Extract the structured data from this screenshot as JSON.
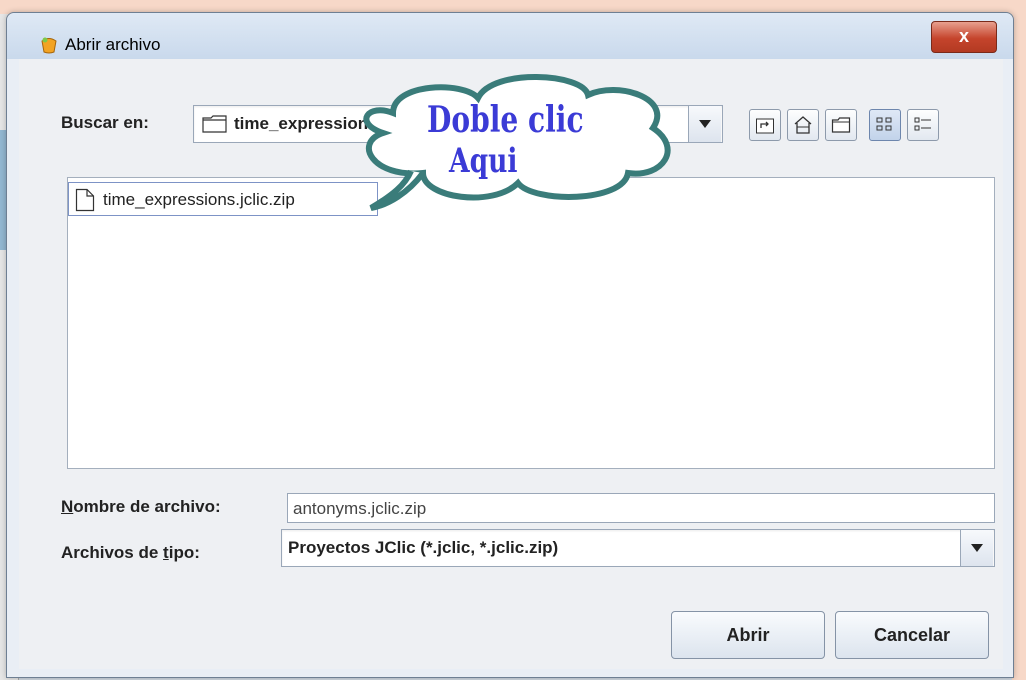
{
  "dialog": {
    "title": "Abrir archivo",
    "close_glyph": "x",
    "look_in_label": "Buscar en:",
    "look_in_value": "time_expressions",
    "toolbar": {
      "icons": [
        "up-folder-icon",
        "home-icon",
        "new-folder-icon",
        "list-view-icon",
        "details-view-icon"
      ],
      "selected": "list-view-icon"
    },
    "files": [
      {
        "name": "time_expressions.jclic.zip",
        "icon": "document-icon"
      }
    ],
    "filename_label_prefix": "N",
    "filename_label_rest": "ombre de archivo:",
    "filename_value": "antonyms.jclic.zip",
    "filetype_label_prefix": "Archivos de ",
    "filetype_label_mnemonic": "t",
    "filetype_label_rest": "ipo:",
    "filetype_value": "Proyectos JClic (*.jclic, *.jclic.zip)",
    "open_button": "Abrir",
    "cancel_button": "Cancelar"
  },
  "callout": {
    "line1": "Doble clic",
    "line2": "Aqui"
  },
  "colors": {
    "window_frame": "#e9eef5",
    "close_button": "#c5442c",
    "callout_stroke": "#3a7c7a",
    "callout_text": "#3b3bd6",
    "background": "#f7d8c8"
  }
}
